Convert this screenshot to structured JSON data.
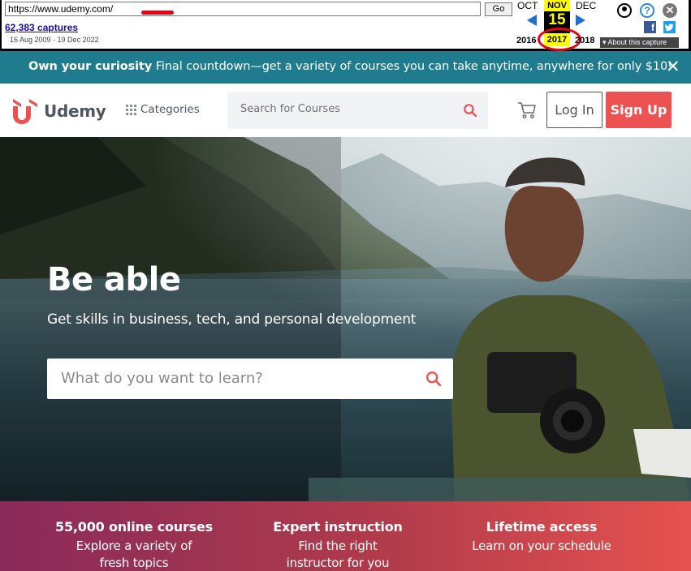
{
  "wayback": {
    "url": "https://www.udemy.com/",
    "go_label": "Go",
    "captures": "62,383 captures",
    "date_range": "16 Aug 2009 - 19 Dec 2022",
    "prev_month": "OCT",
    "current_month": "NOV",
    "next_month": "DEC",
    "current_day": "15",
    "prev_year": "2016",
    "current_year": "2017",
    "next_year": "2018",
    "about_label": "About this capture",
    "facebook": "f",
    "accent": "#ffff00"
  },
  "promo": {
    "bold": "Own your curiosity",
    "text": " Final countdown—get a variety of courses you can take anytime, anywhere for only $10!",
    "close": "✕",
    "color": "#1e7c8e"
  },
  "header": {
    "logo_text": "Udemy",
    "categories_label": "Categories",
    "search_placeholder": "Search for Courses",
    "login_label": "Log In",
    "signup_label": "Sign Up",
    "brand_color": "#ec5252"
  },
  "hero": {
    "title": "Be able",
    "subtitle": "Get skills in business, tech, and personal development",
    "search_placeholder": "What do you want to learn?"
  },
  "features": [
    {
      "title": "55,000 online courses",
      "desc": "Explore a variety of fresh topics"
    },
    {
      "title": "Expert instruction",
      "desc": "Find the right instructor for you"
    },
    {
      "title": "Lifetime access",
      "desc": "Learn on your schedule"
    }
  ]
}
